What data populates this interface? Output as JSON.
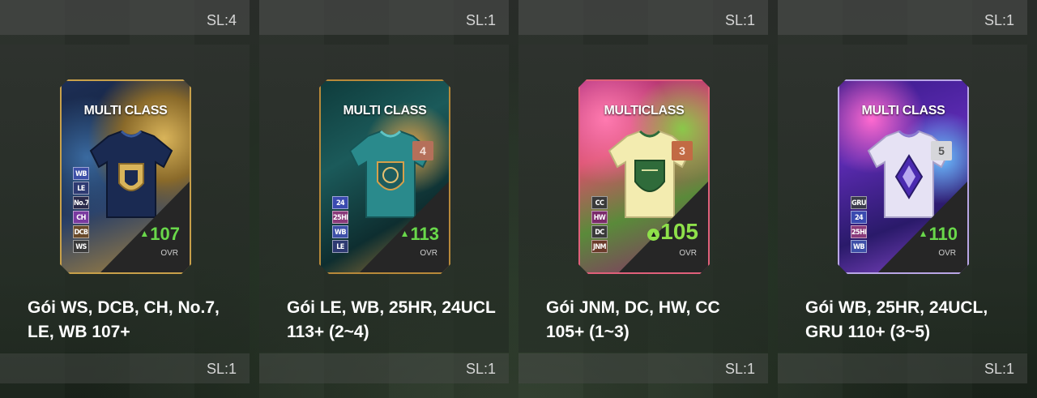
{
  "colors": {
    "ovr_green": "#69d84a",
    "panel": "#2e322e",
    "strip": "#4e504e"
  },
  "packs": [
    {
      "top_sl": "SL:4",
      "bottom_sl": "SL:1",
      "name_line1": "Gói WS, DCB, CH, No.7,",
      "name_line2": "LE, WB 107+",
      "card": {
        "class_title": "MULTI CLASS",
        "rank": "",
        "badges": [
          "WB",
          "LE",
          "No.7",
          "CH",
          "DCB",
          "WS"
        ],
        "ovr": "107",
        "ovr_label": "OVR",
        "theme": "gold-navy"
      }
    },
    {
      "top_sl": "SL:1",
      "bottom_sl": "SL:1",
      "name_line1": "Gói LE, WB, 25HR, 24UCL",
      "name_line2": "113+ (2~4)",
      "card": {
        "class_title": "MULTI CLASS",
        "rank": "4",
        "badges": [
          "24",
          "25HR",
          "WB",
          "LE"
        ],
        "ovr": "113",
        "ovr_label": "OVR",
        "theme": "teal-gold"
      }
    },
    {
      "top_sl": "SL:1",
      "bottom_sl": "SL:1",
      "name_line1": "Gói JNM, DC, HW, CC",
      "name_line2": "105+ (1~3)",
      "card": {
        "class_title": "MULTICLASS",
        "rank": "3",
        "badges": [
          "CC",
          "HW",
          "DC",
          "JNM"
        ],
        "ovr": "105",
        "ovr_label": "OVR",
        "theme": "pink-green"
      }
    },
    {
      "top_sl": "SL:1",
      "bottom_sl": "SL:1",
      "name_line1": "Gói WB, 25HR, 24UCL,",
      "name_line2": "GRU 110+ (3~5)",
      "card": {
        "class_title": "MULTI CLASS",
        "rank": "5",
        "badges": [
          "GRU",
          "24",
          "25HR",
          "WB"
        ],
        "ovr": "110",
        "ovr_label": "OVR",
        "theme": "purple-silver"
      }
    }
  ]
}
